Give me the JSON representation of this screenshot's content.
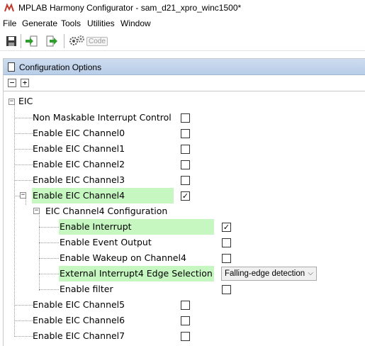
{
  "window": {
    "title": "MPLAB Harmony Configurator - sam_d21_xpro_winc1500*"
  },
  "menu": [
    "File",
    "Generate",
    "Tools",
    "Utilities",
    "Window"
  ],
  "toolbar": {
    "code_label": "Code"
  },
  "panel": {
    "title": "Configuration Options",
    "expand_all": "+",
    "collapse_all": "−"
  },
  "tree": {
    "root": "EIC",
    "items": [
      {
        "label": "Non Maskable Interrupt Control",
        "checked": false
      },
      {
        "label": "Enable EIC Channel0",
        "checked": false
      },
      {
        "label": "Enable EIC Channel1",
        "checked": false
      },
      {
        "label": "Enable EIC Channel2",
        "checked": false
      },
      {
        "label": "Enable EIC Channel3",
        "checked": false
      },
      {
        "label": "Enable EIC Channel4",
        "checked": true,
        "highlighted": true
      },
      {
        "label": "EIC Channel4 Configuration"
      },
      {
        "label": "Enable Interrupt",
        "checked": true,
        "highlighted": true
      },
      {
        "label": "Enable Event Output",
        "checked": false
      },
      {
        "label": "Enable Wakeup on Channel4",
        "checked": false
      },
      {
        "label": "External Interrupt4 Edge Selection",
        "highlighted": true,
        "value": "Falling-edge detection"
      },
      {
        "label": "Enable filter",
        "checked": false
      },
      {
        "label": "Enable EIC Channel5",
        "checked": false
      },
      {
        "label": "Enable EIC Channel6",
        "checked": false
      },
      {
        "label": "Enable EIC Channel7",
        "checked": false
      }
    ]
  },
  "checkmark": "✓",
  "colors": {
    "highlight": "#c6f7c0",
    "panel_header": "#c3d5ee"
  }
}
